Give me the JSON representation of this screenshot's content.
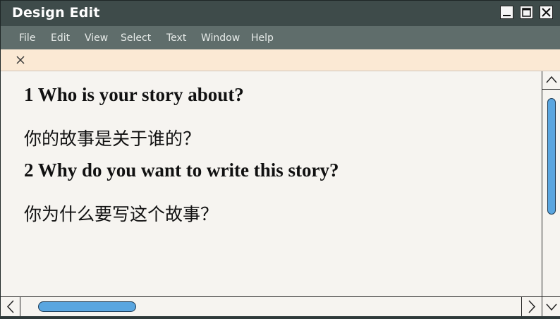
{
  "window": {
    "title": "Design Edit"
  },
  "window_controls": {
    "minimize_icon": "minimize-icon",
    "maximize_icon": "maximize-icon",
    "close_icon": "close-icon"
  },
  "menubar": {
    "items": [
      "File",
      "Edit",
      "View",
      "Select",
      "Text",
      "Window",
      "Help"
    ]
  },
  "tabbar": {
    "close_icon": "close-icon"
  },
  "document": {
    "lines": [
      "1 Who is your story about?",
      "你的故事是关于谁的？",
      "2 Why do you want to write this story?",
      "你为什么要写这个故事？"
    ]
  },
  "colors": {
    "titlebar": "#3e4b4a",
    "menubar": "#5f6d6b",
    "tabbar": "#fbe9d4",
    "content_bg": "#f6f4f0",
    "scroll_thumb": "#5aa6e0"
  }
}
